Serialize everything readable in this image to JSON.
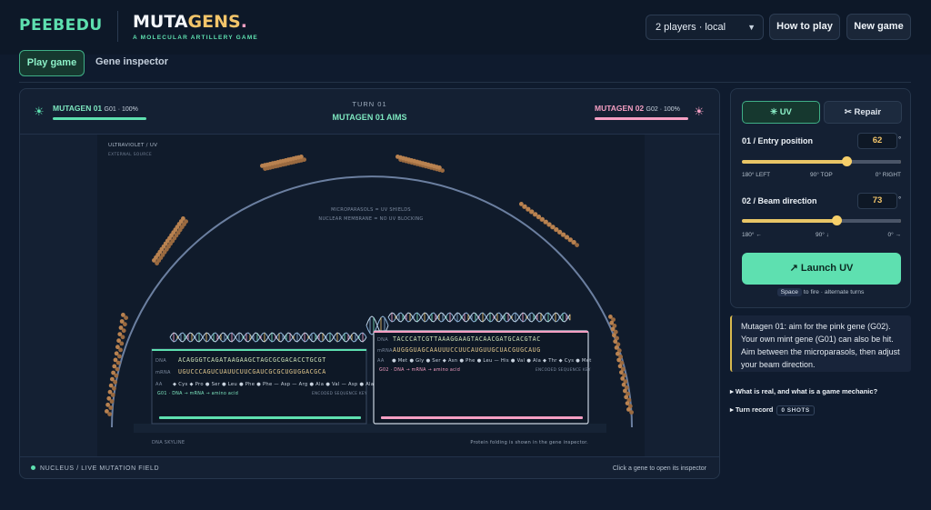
{
  "header": {
    "logo": "PEEBEDU",
    "brand_title_a": "MUTA",
    "brand_title_b": "GENS",
    "brand_title_dot": ".",
    "brand_subtitle": "A MOLECULAR ARTILLERY GAME",
    "players_select": "2 players · local",
    "how_to_play": "How to play",
    "new_game": "New game"
  },
  "tabs": {
    "play": "Play game",
    "inspector": "Gene inspector"
  },
  "game": {
    "player1": {
      "name": "MUTAGEN 01",
      "stat": "G01 · 100%",
      "health": 1.0
    },
    "player2": {
      "name": "MUTAGEN 02",
      "stat": "G02 · 100%",
      "health": 1.0
    },
    "turn_label": "TURN 01",
    "turn_status": "MUTAGEN 01 AIMS",
    "field": {
      "uv_label": "ULTRAVIOLET / UV",
      "uv_sub": "EXTERNAL SOURCE",
      "shield_label": "MICROPARASOLS = UV SHIELDS",
      "membrane_label": "NUCLEAR MEMBRANE = NO UV BLOCKING",
      "skyline_label": "DNA SKYLINE",
      "folding_note": "Protein folding is shown in the gene inspector.",
      "gene1": {
        "dna_tag": "DNA",
        "dna": "ACAGGGTCAGATAAGAAGCTAGCGCGACACCTGCGT",
        "mrna_tag": "mRNA",
        "mrna": "UGUCCCAGUCUAUUCUUCGAUCGCGCUGUGGACGCA",
        "aa_tag": "AA",
        "aa": "◆ Cys ◆ Pro ● Ser ● Leu ● Phe ● Phe — Asp — Arg ● Ala ● Val — Asp ● Ala",
        "legend": "G01 · DNA → mRNA → amino acid",
        "legend_right": "ENCODED SEQUENCE KEY"
      },
      "gene2": {
        "dna_tag": "DNA",
        "dna": "TACCCATCGTTAAAGGAAGTACAACGATGCACGTAC",
        "mrna_tag": "mRNA",
        "mrna": "AUGGGUAGCAAUUUCCUUCAUGUUGCUACGUGCAUG",
        "aa_tag": "AA",
        "aa": "● Met ● Gly ● Ser ◆ Asn ● Phe ● Leu — His ● Val ● Ala ◆ Thr ◆ Cys ● Met",
        "legend": "G02 · DNA → mRNA → amino acid",
        "legend_right": "ENCODED SEQUENCE KEY"
      }
    },
    "footer_left": "NUCLEUS / LIVE MUTATION FIELD",
    "footer_right": "Click a gene to open its inspector"
  },
  "controls": {
    "uv_mode": "✳ UV",
    "repair_mode": "✂ Repair",
    "entry_label": "01 / Entry position",
    "entry_value": "62",
    "entry_unit": "°",
    "entry_range": [
      0,
      180
    ],
    "entry_ticks": [
      "180° LEFT",
      "90° TOP",
      "0° RIGHT"
    ],
    "beam_label": "02 / Beam direction",
    "beam_value": "73",
    "beam_unit": "°",
    "beam_range": [
      0,
      180
    ],
    "beam_ticks": [
      "180° ←",
      "90° ↓",
      "0° →"
    ],
    "launch": "↗ Launch UV",
    "hint_key": "Space",
    "hint_text": "to fire · alternate turns"
  },
  "message": "Mutagen 01: aim for the pink gene (G02). Your own mint gene (G01) can also be hit. Aim between the microparasols, then adjust your beam direction.",
  "disclosures": {
    "real_vs_mechanic": "▸ What is real, and what is a game mechanic?",
    "turn_record": "▸ Turn record",
    "shots_badge": "0 SHOTS"
  },
  "colors": {
    "mint": "#5ee0b0",
    "pink": "#f59fc3",
    "gold": "#f3c56a",
    "background": "#0f1b2e"
  }
}
